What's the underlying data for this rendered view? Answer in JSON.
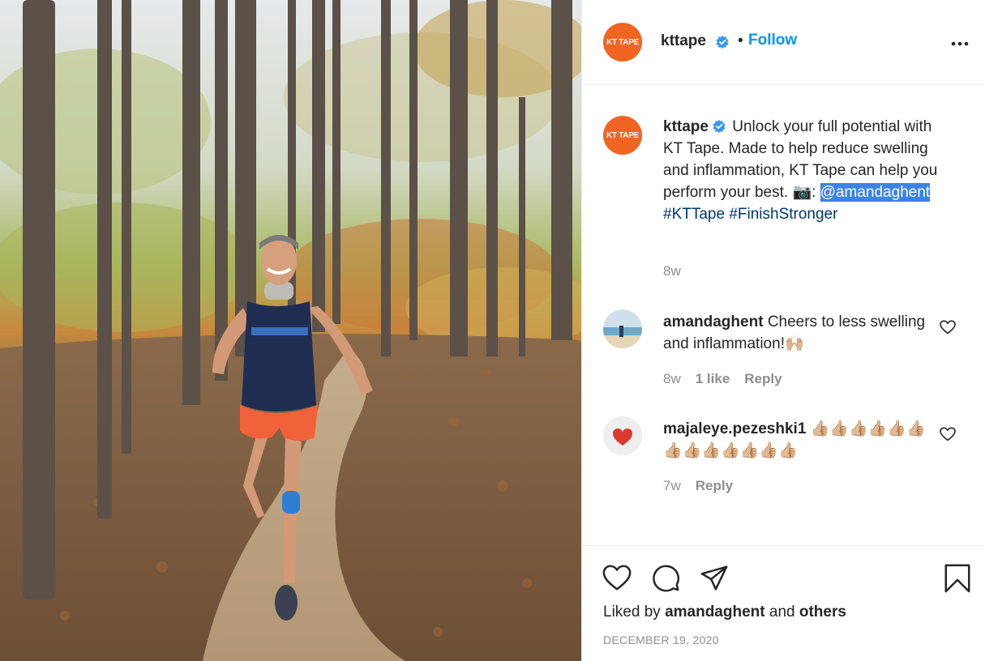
{
  "post": {
    "photo_alt": "",
    "author": "kttape",
    "avatar_text": "KT TAPE",
    "follow_label": "Follow",
    "separator": "•",
    "caption": {
      "text": "Unlock your full potential with KT Tape. Made to help reduce swelling and inflammation, KT Tape can help you perform your best. 📷:",
      "mention": "@amandaghent",
      "tags": [
        "#KTTape",
        "#FinishStronger"
      ],
      "time": "8w"
    },
    "comments": [
      {
        "user": "amandaghent",
        "text": "Cheers to less swelling and inflammation!🙌🏼",
        "time": "8w",
        "likes": "1 like",
        "reply_label": "Reply"
      },
      {
        "user": "majaleye.pezeshki1",
        "text": "👍🏼👍🏼👍🏼👍🏼👍🏼👍🏼👍🏼👍🏼👍🏼👍🏼👍🏼👍🏼👍🏼",
        "time": "7w",
        "reply_label": "Reply"
      }
    ],
    "liked_by": {
      "prefix": "Liked by",
      "user": "amandaghent",
      "conj": "and",
      "others": "others"
    },
    "date": "DECEMBER 19, 2020"
  },
  "colors": {
    "brand": "#f26422",
    "link": "#0095f6",
    "hashtag": "#00376b",
    "muted": "#8e8e8e",
    "verified": "#3897f0"
  },
  "icons": {
    "verified": "verified-badge-icon",
    "more": "more-options-icon",
    "like": "heart-icon",
    "comment": "comment-bubble-icon",
    "share": "paper-plane-icon",
    "save": "bookmark-icon"
  }
}
